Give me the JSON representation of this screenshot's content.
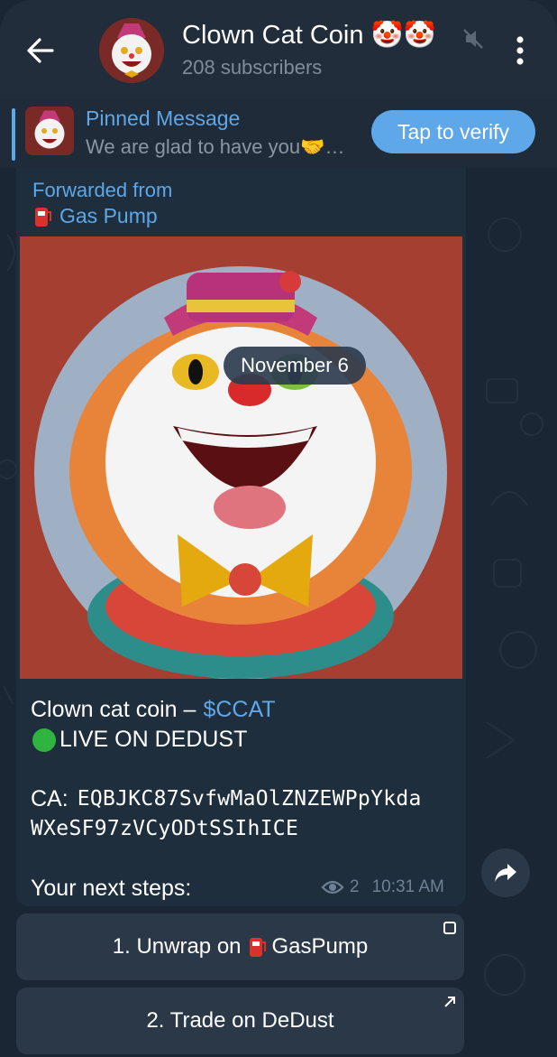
{
  "header": {
    "title": "Clown Cat Coin 🤡🤡",
    "subtitle": "208 subscribers",
    "icons": [
      "back-arrow-icon",
      "channel-avatar",
      "muted-icon",
      "more-vert-icon"
    ]
  },
  "pinned": {
    "title": "Pinned Message",
    "text": "We are glad to have you🤝…",
    "button_label": "Tap to verify"
  },
  "message": {
    "forwarded_label": "Forwarded from",
    "forwarded_source": "Gas Pump",
    "date": "November 6",
    "line1_text": "Clown cat coin –",
    "line1_link": "$CCAT",
    "line2": "LIVE ON DEDUST",
    "ca_label": "CA:",
    "ca_line1": "EQBJKC87SvfwMaOlZNZEWPpYkda",
    "ca_line2": "WXeSF97zVCyODtSSIhICE",
    "steps_label": "Your next steps:",
    "views": "2",
    "time": "10:31 AM"
  },
  "buttons": [
    {
      "label_prefix": "1. Unwrap on",
      "label_suffix": "GasPump"
    },
    {
      "label": "2. Trade on DeDust"
    }
  ],
  "colors": {
    "accent": "#5ea7e8",
    "header_bg": "#212d3b",
    "bubble_bg": "#1f2e3d",
    "media_bg": "#a43f32",
    "live_dot": "#2fb53f"
  }
}
